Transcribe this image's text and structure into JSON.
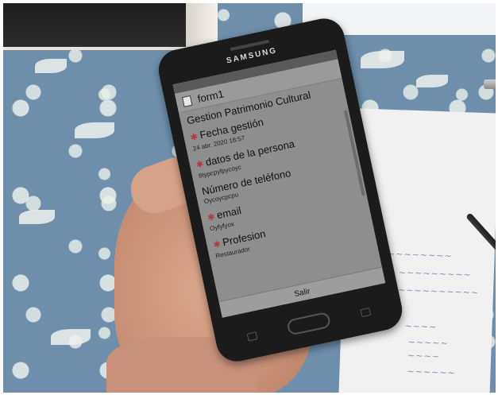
{
  "phone": {
    "brand": "SAMSUNG",
    "app_title": "form1",
    "form_name": "Gestion Patrimonio Cultural",
    "fields": [
      {
        "label": "Fecha gestión",
        "value": "24 abr. 2020 18:57",
        "required": true
      },
      {
        "label": "datos de la persona",
        "value": "8typcpyfpycoyc",
        "required": true
      },
      {
        "label": "Número de teléfono",
        "value": "Oycoycpcpu",
        "required": false
      },
      {
        "label": "email",
        "value": "Oyfyfyox",
        "required": true
      },
      {
        "label": "Profesion",
        "value": "Restaurador",
        "required": true
      }
    ],
    "exit_label": "Salir"
  },
  "icons": {
    "form": "form-icon",
    "home": "home-button-icon",
    "back": "back-icon",
    "recent": "recent-apps-icon"
  }
}
